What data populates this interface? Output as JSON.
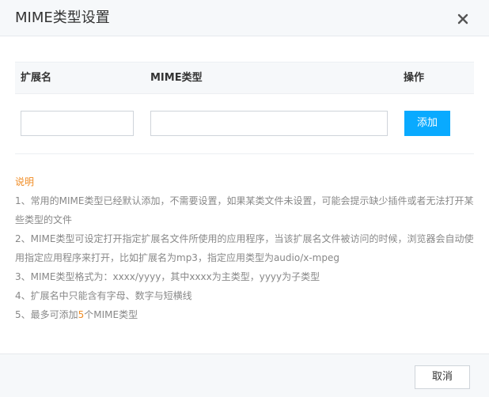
{
  "dialog": {
    "title": "MIME类型设置",
    "close_icon": "close-icon"
  },
  "table": {
    "headers": {
      "extension": "扩展名",
      "mime_type": "MIME类型",
      "action": "操作"
    },
    "row": {
      "extension_value": "",
      "mime_value": "",
      "add_label": "添加"
    }
  },
  "notes": {
    "title": "说明",
    "lines": [
      "1、常用的MIME类型已经默认添加，不需要设置，如果某类文件未设置，可能会提示缺少插件或者无法打开某些类型的文件",
      "2、MIME类型可设定打开指定扩展名文件所使用的应用程序，当该扩展名文件被访问的时候，浏览器会自动使用指定应用程序来打开，比如扩展名为mp3，指定应用类型为audio/x-mpeg",
      "3、MIME类型格式为：xxxx/yyyy，其中xxxx为主类型，yyyy为子类型",
      "4、扩展名中只能含有字母、数字与短横线"
    ],
    "line5_prefix": "5、最多可添加",
    "line5_count": "5",
    "line5_suffix": "个MIME类型"
  },
  "footer": {
    "cancel_label": "取消"
  },
  "colors": {
    "accent": "#09aaff",
    "note_highlight": "#f08c24",
    "header_bg": "#f6f8fa"
  }
}
